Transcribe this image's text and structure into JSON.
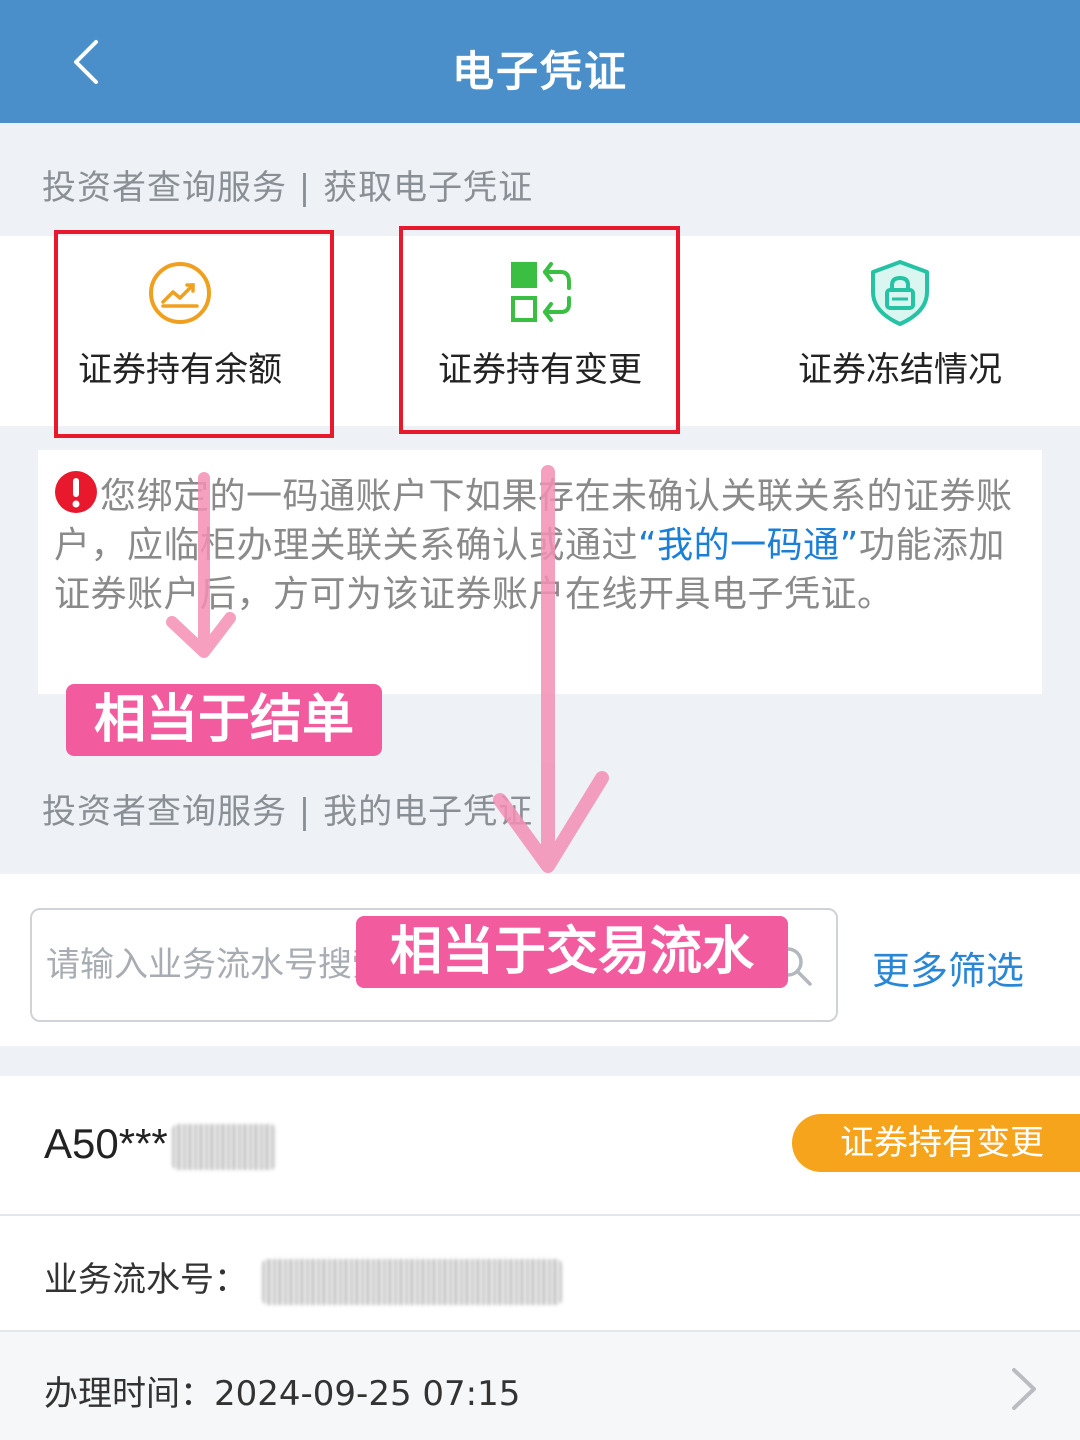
{
  "header": {
    "title": "电子凭证"
  },
  "section1": {
    "label": "投资者查询服务 | 获取电子凭证"
  },
  "services": [
    {
      "label": "证券持有余额",
      "icon": "chart-trend-icon"
    },
    {
      "label": "证券持有变更",
      "icon": "swap-blocks-icon"
    },
    {
      "label": "证券冻结情况",
      "icon": "shield-lock-icon"
    }
  ],
  "notice": {
    "text_before": "您绑定的一码通账户下如果存在未确认关联关系的证券账户，应临柜办理关联关系确认或通过",
    "link": "“我的一码通”",
    "text_after": "功能添加证券账户后，方可为该证券账户在线开具电子凭证。"
  },
  "annotations": {
    "first": "相当于结单",
    "second": "相当于交易流水"
  },
  "section2": {
    "label": "投资者查询服务 | 我的电子凭证"
  },
  "search": {
    "placeholder": "请输入业务流水号搜索",
    "more_filter": "更多筛选"
  },
  "record": {
    "account": "A50***",
    "tag": "证券持有变更",
    "serial_label": "业务流水号：",
    "time_label": "办理时间：",
    "time_value": "2024-09-25 07:15"
  },
  "colors": {
    "header": "#4a8fc9",
    "link": "#1b7fd8",
    "tag": "#f6a41b",
    "annotation": "#f25c9f",
    "highlight": "#e8192c"
  }
}
